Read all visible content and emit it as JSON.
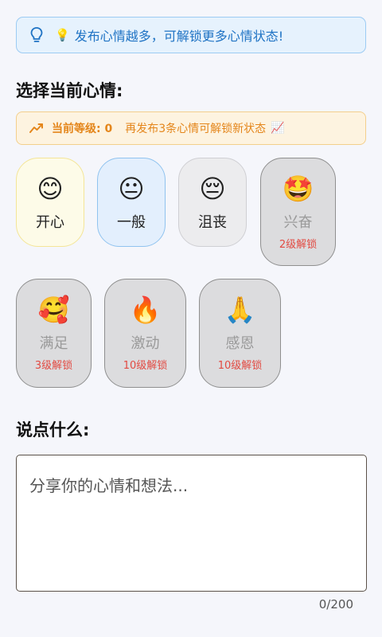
{
  "tip": {
    "emoji": "💡",
    "text": "发布心情越多，可解锁更多心情状态!"
  },
  "mood_section": {
    "title": "选择当前心情:"
  },
  "level": {
    "label": "当前等级: 0",
    "hint": "再发布3条心情可解锁新状态",
    "hint_emoji": "📈"
  },
  "moods": [
    {
      "emoji": "😊",
      "label": "开心"
    },
    {
      "emoji": "😐",
      "label": "一般"
    },
    {
      "emoji": "😔",
      "label": "沮丧"
    },
    {
      "emoji": "🤩",
      "label": "兴奋",
      "lock": "2级解锁"
    },
    {
      "emoji": "🥰",
      "label": "满足",
      "lock": "3级解锁"
    },
    {
      "emoji": "🔥",
      "label": "激动",
      "lock": "10级解锁"
    },
    {
      "emoji": "🙏",
      "label": "感恩",
      "lock": "10级解锁"
    }
  ],
  "say_section": {
    "title": "说点什么:"
  },
  "input": {
    "placeholder": "分享你的心情和想法...",
    "value": ""
  },
  "counter": "0/200",
  "colors": {
    "accent_blue": "#1f73c4",
    "level_orange": "#e4861b",
    "lock_red": "#e24a42"
  }
}
